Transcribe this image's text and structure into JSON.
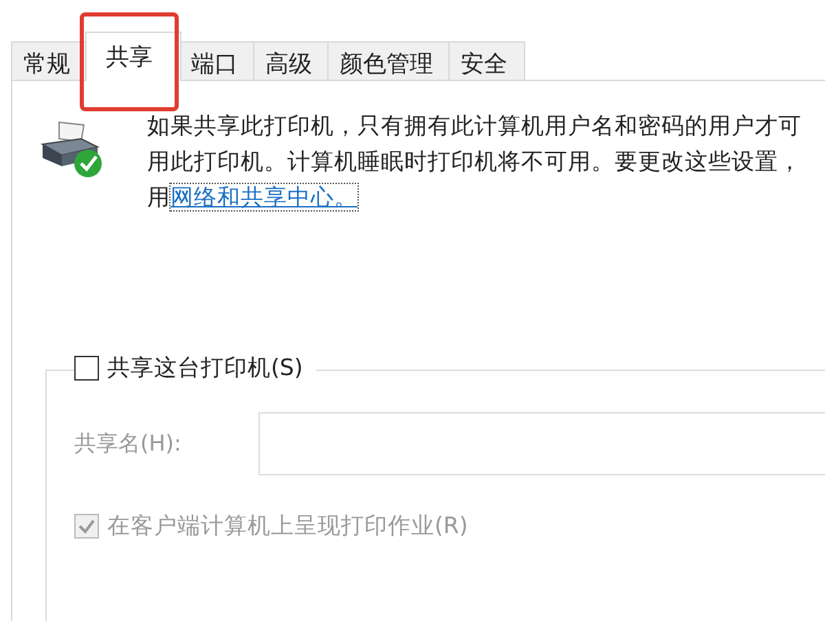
{
  "tabs": [
    {
      "label": "常规",
      "selected": false,
      "highlighted": false
    },
    {
      "label": "共享",
      "selected": true,
      "highlighted": true
    },
    {
      "label": "端口",
      "selected": false,
      "highlighted": false
    },
    {
      "label": "高级",
      "selected": false,
      "highlighted": false
    },
    {
      "label": "颜色管理",
      "selected": false,
      "highlighted": false
    },
    {
      "label": "安全",
      "selected": false,
      "highlighted": false
    }
  ],
  "description": {
    "lines": [
      "如果共享此打印机，只有拥有此计算机用户名和密码的用户才可",
      "用此打印机。计算机睡眠时打印机将不可用。要更改这些设置，"
    ],
    "prefix": "用",
    "link": "网络和共享中心。"
  },
  "share_group": {
    "share_checkbox": {
      "label": "共享这台打印机(S)",
      "checked": false
    },
    "share_name": {
      "label": "共享名(H):",
      "disabled": true
    },
    "render_checkbox": {
      "label": "在客户端计算机上呈现打印作业(R)",
      "checked": true,
      "disabled": true
    }
  }
}
